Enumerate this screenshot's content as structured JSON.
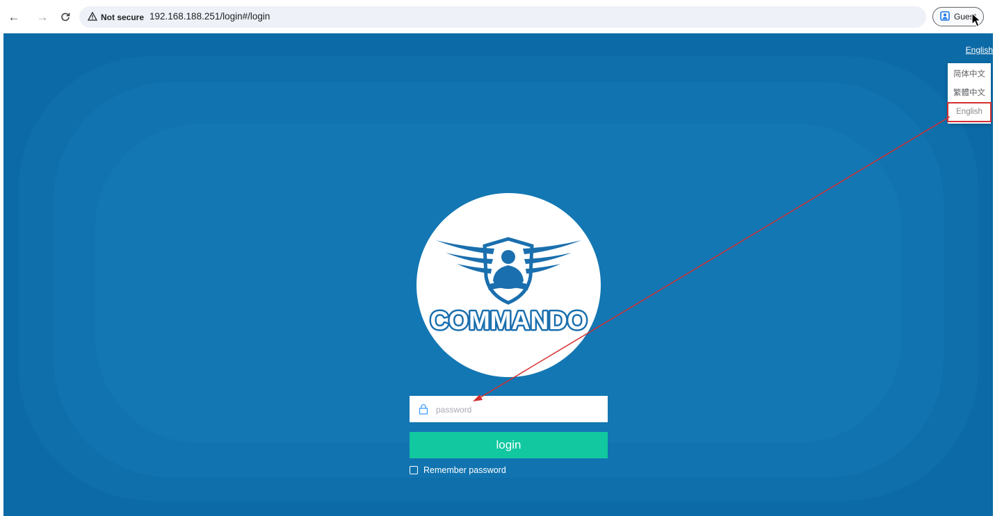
{
  "browser": {
    "security_label": "Not secure",
    "url": "192.168.188.251/login#/login",
    "profile_label": "Guest",
    "icons": {
      "back": "back-arrow-icon",
      "forward": "forward-arrow-icon",
      "reload": "reload-icon",
      "warning": "warning-icon",
      "profile": "profile-icon"
    }
  },
  "language": {
    "current": "English",
    "options": [
      "简体中文",
      "繁體中文",
      "English"
    ],
    "selected_index": 2
  },
  "logo": {
    "brand_text": "COMMANDO",
    "color": "#1a6fae"
  },
  "login_form": {
    "password_placeholder": "password",
    "password_value": "",
    "login_label": "login",
    "remember_label": "Remember password",
    "remember_checked": false
  },
  "colors": {
    "background": "#0c6aa6",
    "login_button": "#11c8a0",
    "annotation": "#d32f2f"
  }
}
